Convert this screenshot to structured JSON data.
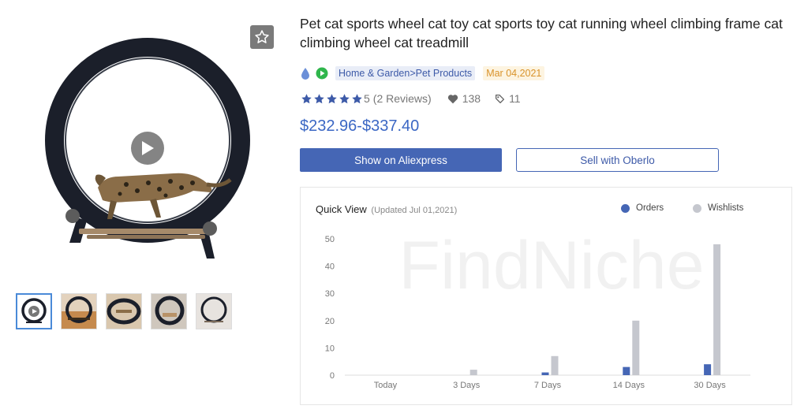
{
  "product": {
    "title": "Pet cat sports wheel cat toy cat sports toy cat running wheel climbing frame cat climbing wheel cat treadmill",
    "category": "Home & Garden>Pet Products",
    "date": "Mar 04,2021",
    "rating_value": "5",
    "reviews": "(2 Reviews)",
    "likes": "138",
    "tags": "11",
    "price": "$232.96-$337.40"
  },
  "actions": {
    "aliexpress_label": "Show on Aliexpress",
    "oberlo_label": "Sell with Oberlo"
  },
  "colors": {
    "primary": "#4566b5",
    "orders": "#4566b5",
    "wishlists": "#c5c7ce",
    "price": "#3b67c4",
    "date_text": "#d9932b"
  },
  "icons": [
    "star-icon",
    "drop-icon",
    "play-circle-icon",
    "heart-icon",
    "tag-icon",
    "play-icon"
  ],
  "thumbnails": {
    "count": 5,
    "active_index": 0
  },
  "quick_view": {
    "title": "Quick View",
    "updated": "(Updated Jul 01,2021)",
    "watermark": "FindNiche"
  },
  "chart_data": {
    "type": "bar",
    "categories": [
      "Today",
      "3 Days",
      "7 Days",
      "14 Days",
      "30 Days"
    ],
    "series": [
      {
        "name": "Orders",
        "values": [
          0,
          0,
          1,
          3,
          4
        ]
      },
      {
        "name": "Wishlists",
        "values": [
          0,
          2,
          7,
          20,
          48
        ]
      }
    ],
    "ylim": [
      0,
      50
    ],
    "yticks": [
      0,
      10,
      20,
      30,
      40,
      50
    ],
    "legend_position": "top-right",
    "grid": false
  }
}
